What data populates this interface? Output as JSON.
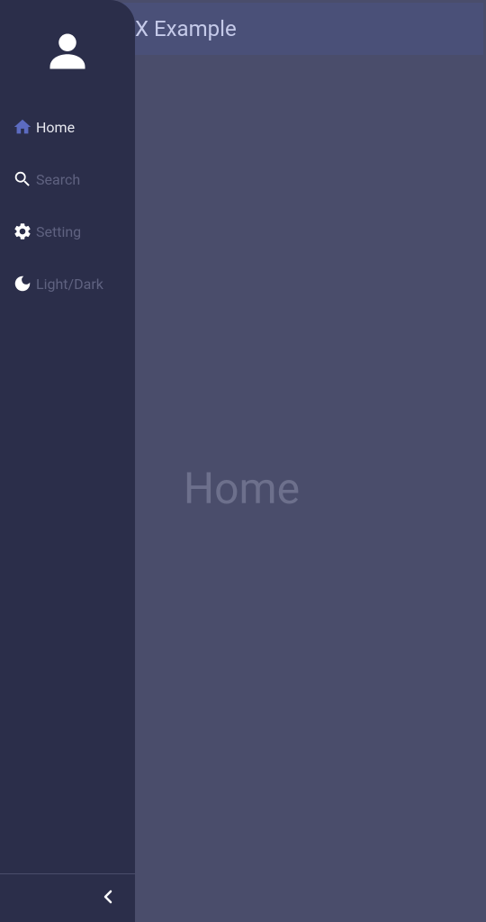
{
  "appbar": {
    "title": "X Example"
  },
  "main": {
    "page_title": "Home"
  },
  "drawer": {
    "items": [
      {
        "label": "Home",
        "icon": "home-icon",
        "active": true
      },
      {
        "label": "Search",
        "icon": "search-icon",
        "active": false
      },
      {
        "label": "Setting",
        "icon": "settings-icon",
        "active": false
      },
      {
        "label": "Light/Dark",
        "icon": "moon-icon",
        "active": false
      }
    ]
  },
  "colors": {
    "appbar_bg": "#4a5078",
    "drawer_bg": "#2b2e4a",
    "content_bg": "#4a4d6b",
    "accent": "#5c6bc0",
    "icon_white": "#ffffff",
    "text_active": "#e8e9f0",
    "text_inactive": "#5f6280"
  }
}
